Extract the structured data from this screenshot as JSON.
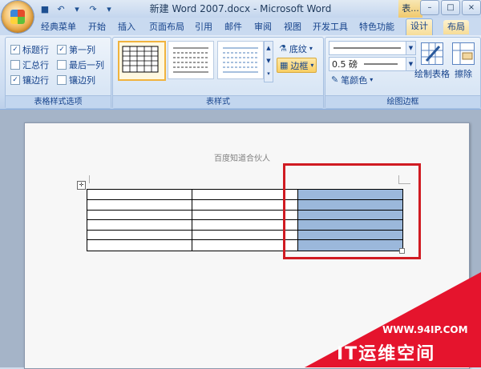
{
  "window": {
    "title": "新建 Word 2007.docx - Microsoft Word",
    "context_title": "表...",
    "controls": [
      "–",
      "□",
      "×"
    ]
  },
  "tabs": [
    {
      "label": "经典菜单"
    },
    {
      "label": "开始"
    },
    {
      "label": "插入"
    },
    {
      "label": "页面布局"
    },
    {
      "label": "引用"
    },
    {
      "label": "邮件"
    },
    {
      "label": "审阅"
    },
    {
      "label": "视图"
    },
    {
      "label": "开发工具"
    },
    {
      "label": "特色功能"
    },
    {
      "label": "设计"
    },
    {
      "label": "布局"
    }
  ],
  "ribbon": {
    "options_group": {
      "label": "表格样式选项",
      "checks": [
        {
          "label": "标题行",
          "checked": true
        },
        {
          "label": "第一列",
          "checked": true
        },
        {
          "label": "汇总行",
          "checked": false
        },
        {
          "label": "最后一列",
          "checked": false
        },
        {
          "label": "镶边行",
          "checked": true
        },
        {
          "label": "镶边列",
          "checked": false
        }
      ]
    },
    "styles_group": {
      "label": "表样式",
      "shading": "底纹",
      "borders": "边框"
    },
    "draw_group": {
      "label": "绘图边框",
      "weight": "0.5 磅",
      "pen_color": "笔颜色",
      "draw_table": "绘制表格",
      "eraser": "擦除"
    }
  },
  "document": {
    "header_text": "百度知道合伙人",
    "table_rows": 6,
    "table_cols": 3,
    "selected_column": 3,
    "highlight_color": "#d01b22"
  },
  "watermark": {
    "url": "WWW.94IP.COM",
    "name": "IT运维空间",
    "color": "#e5142d"
  }
}
